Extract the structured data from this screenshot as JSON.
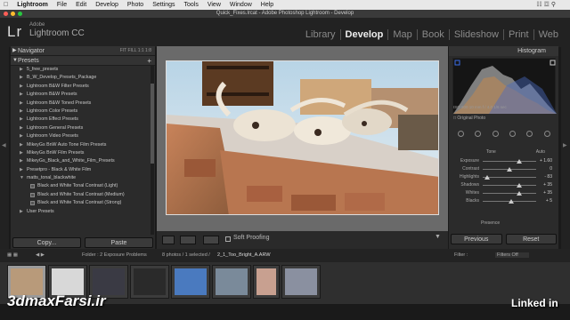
{
  "menubar": {
    "app": "Lightroom",
    "items": [
      "File",
      "Edit",
      "Develop",
      "Photo",
      "Settings",
      "Tools",
      "View",
      "Window",
      "Help"
    ]
  },
  "window_title": "Quick_Fixes.lrcat - Adobe Photoshop Lightroom - Develop",
  "brand": {
    "top": "Adobe",
    "name": "Lightroom CC",
    "logo": "Lr"
  },
  "modules": [
    {
      "label": "Library",
      "active": false
    },
    {
      "label": "Develop",
      "active": true
    },
    {
      "label": "Map",
      "active": false
    },
    {
      "label": "Book",
      "active": false
    },
    {
      "label": "Slideshow",
      "active": false
    },
    {
      "label": "Print",
      "active": false
    },
    {
      "label": "Web",
      "active": false
    }
  ],
  "left_panel": {
    "navigator": {
      "title": "Navigator",
      "options": "FIT  FILL  1:1  1:8"
    },
    "presets": {
      "title": "Presets",
      "add": "+",
      "items": [
        {
          "label": "5_free_presets",
          "sub": false
        },
        {
          "label": "B_W_Develop_Presets_Package",
          "sub": false
        },
        {
          "label": "Lightroom B&W Filter Presets",
          "sub": false
        },
        {
          "label": "Lightroom B&W Presets",
          "sub": false
        },
        {
          "label": "Lightroom B&W Toned Presets",
          "sub": false
        },
        {
          "label": "Lightroom Color Presets",
          "sub": false
        },
        {
          "label": "Lightroom Effect Presets",
          "sub": false
        },
        {
          "label": "Lightroom General Presets",
          "sub": false
        },
        {
          "label": "Lightroom Video Presets",
          "sub": false
        },
        {
          "label": "MikeyGs BnW Auto Tone Film Presets",
          "sub": false
        },
        {
          "label": "MikeyGs BnW Film Presets",
          "sub": false
        },
        {
          "label": "MikeyGs_Black_and_White_Film_Presets",
          "sub": false
        },
        {
          "label": "Presetpro - Black & White Film",
          "sub": false
        },
        {
          "label": "matts_tonal_blackwhite",
          "sub": false,
          "open": true
        },
        {
          "label": "Black and White Tonal Contrast (Light)",
          "sub": true
        },
        {
          "label": "Black and White Tonal Contrast (Medium)",
          "sub": true
        },
        {
          "label": "Black and White Tonal Contrast (Strong)",
          "sub": true
        },
        {
          "label": "User Presets",
          "sub": false
        }
      ]
    },
    "copy": "Copy...",
    "paste": "Paste"
  },
  "toolbar": {
    "soft_proofing": "Soft Proofing"
  },
  "right_panel": {
    "histogram_title": "Histogram",
    "histogram_info": "ISO 800   10 mm   f / 4.0   1/6 sec",
    "original_photo": "Original Photo",
    "basic": {
      "tone": "Tone",
      "auto": "Auto",
      "sliders": [
        {
          "name": "Exposure",
          "value": "+ 1.60",
          "pos": 0.68
        },
        {
          "name": "Contrast",
          "value": "0",
          "pos": 0.5
        },
        {
          "name": "Highlights",
          "value": "- 83",
          "pos": 0.08
        },
        {
          "name": "Shadows",
          "value": "+ 35",
          "pos": 0.68
        },
        {
          "name": "Whites",
          "value": "+ 35",
          "pos": 0.68
        },
        {
          "name": "Blacks",
          "value": "+ 5",
          "pos": 0.53
        }
      ],
      "presence": "Presence"
    },
    "previous": "Previous",
    "reset": "Reset"
  },
  "filmstrip_header": {
    "folder": "Folder : 2 Exposure Problems",
    "count": "8 photos / 1 selected /",
    "file": "2_1_Too_Bright_A.ARW",
    "filter": "Filter :",
    "filters_off": "Filters Off"
  },
  "filmstrip": {
    "thumbs": [
      {
        "selected": true,
        "color": "#b89a7a"
      },
      {
        "selected": false,
        "color": "#d8d8d8"
      },
      {
        "selected": false,
        "color": "#3a3a44"
      },
      {
        "selected": false,
        "color": "#2a2a2a"
      },
      {
        "selected": false,
        "color": "#4a7abf"
      },
      {
        "selected": false,
        "color": "#7a8a9a"
      },
      {
        "selected": false,
        "color": "#c8a090"
      },
      {
        "selected": false,
        "color": "#8a90a0"
      }
    ]
  },
  "watermarks": {
    "left": "3dmaxFarsi.ir",
    "right": "Linked in"
  },
  "colors": {
    "accent": "#eeeeee",
    "panel": "#2b2b2b",
    "photo_sky": "#9ec0d8"
  }
}
